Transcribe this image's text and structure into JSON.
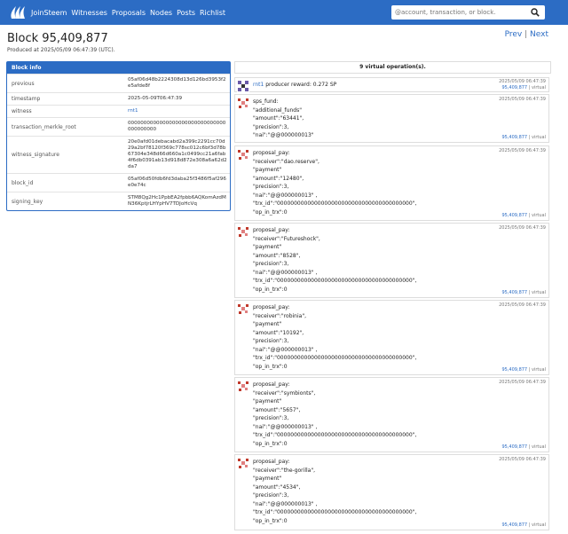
{
  "nav": {
    "links": [
      "JoinSteem",
      "Witnesses",
      "Proposals",
      "Nodes",
      "Posts",
      "Richlist"
    ],
    "search_placeholder": "@account, transaction, or block.",
    "brand_color": "#2c6cc4"
  },
  "header": {
    "title": "Block 95,409,877",
    "produced": "Produced at 2025/05/09 06:47:39 (UTC).",
    "prev": "Prev",
    "sep": "|",
    "next": "Next"
  },
  "block_info": {
    "heading": "Block info",
    "rows": [
      {
        "key": "previous",
        "value": "05af06d48b2224308d13d126bd3953f2e5afde8f"
      },
      {
        "key": "timestamp",
        "value": "2025-05-09T06:47:39"
      },
      {
        "key": "witness",
        "value": "rnt1"
      },
      {
        "key": "transaction_merkle_root",
        "value": "0000000000000000000000000000000000000000"
      },
      {
        "key": "witness_signature",
        "value": "20e0afd01debacabd2a399c2291cc70d29a2bf78120f369c778sc012c6bf3d78b67304e348d66d660a1c0499cc21a6fab4f6db0391ab13d918d872e308a6a62d2da7"
      },
      {
        "key": "block_id",
        "value": "05af06d50fdb6fd3daba25f3486f5af296e0e74c"
      },
      {
        "key": "signing_key",
        "value": "STM8Qg2Hc1PpbEA2fpbb6AQKomAzdMN36KptjrLHYpHV7TDJoHcVq"
      }
    ]
  },
  "ops": {
    "heading": "9 virtual operation(s).",
    "timestamp": "2025/05/09 06:47:39",
    "block_num": "95,409,877",
    "virtual": "virtual",
    "sep": "|",
    "reward": {
      "witness": "rnt1",
      "text": " producer reward: 0.272 SP"
    },
    "items": [
      {
        "type": "sps_fund:",
        "lines": "\"additional_funds\"\n\"amount\":\"63441\",\n\"precision\":3,\n\"nai\":\"@@000000013\""
      },
      {
        "type": "proposal_pay:",
        "lines": "\"receiver\":\"dao.reserve\",\n\"payment\"\n\"amount\":\"12480\",\n\"precision\":3,\n\"nai\":\"@@000000013\" ,\n\"trx_id\":\"0000000000000000000000000000000000000000\",\n\"op_in_trx\":0"
      },
      {
        "type": "proposal_pay:",
        "lines": "\"receiver\":\"Futureshock\",\n\"payment\"\n\"amount\":\"8528\",\n\"precision\":3,\n\"nai\":\"@@000000013\" ,\n\"trx_id\":\"0000000000000000000000000000000000000000\",\n\"op_in_trx\":0"
      },
      {
        "type": "proposal_pay:",
        "lines": "\"receiver\":\"robinia\",\n\"payment\"\n\"amount\":\"10192\",\n\"precision\":3,\n\"nai\":\"@@000000013\" ,\n\"trx_id\":\"0000000000000000000000000000000000000000\",\n\"op_in_trx\":0"
      },
      {
        "type": "proposal_pay:",
        "lines": "\"receiver\":\"symbionts\",\n\"payment\"\n\"amount\":\"5657\",\n\"precision\":3,\n\"nai\":\"@@000000013\" ,\n\"trx_id\":\"0000000000000000000000000000000000000000\",\n\"op_in_trx\":0"
      },
      {
        "type": "proposal_pay:",
        "lines": "\"receiver\":\"the-gorilla\",\n\"payment\"\n\"amount\":\"4534\",\n\"precision\":3,\n\"nai\":\"@@000000013\" ,\n\"trx_id\":\"0000000000000000000000000000000000000000\",\n\"op_in_trx\":0"
      }
    ]
  }
}
